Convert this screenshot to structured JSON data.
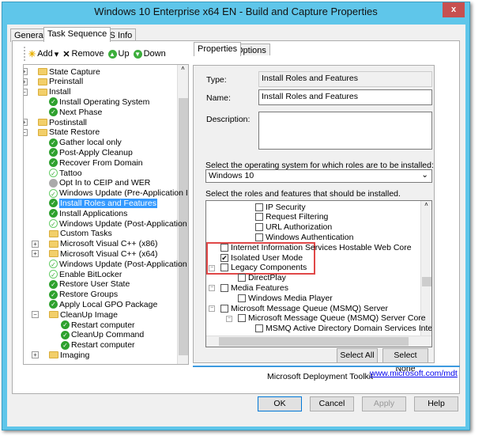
{
  "window": {
    "title": "Windows 10 Enterprise x64 EN - Build and Capture Properties",
    "close": "x"
  },
  "tabs": [
    "General",
    "Task Sequence",
    "OS Info"
  ],
  "active_tab": "Task Sequence",
  "toolbar": {
    "add": "Add",
    "remove": "Remove",
    "up": "Up",
    "down": "Down"
  },
  "tree": [
    {
      "label": "State Capture",
      "level": 0,
      "icon": "folder",
      "expander": "+"
    },
    {
      "label": "Preinstall",
      "level": 0,
      "icon": "folder",
      "expander": "+"
    },
    {
      "label": "Install",
      "level": 0,
      "icon": "folder",
      "expander": "-"
    },
    {
      "label": "Install Operating System",
      "level": 1,
      "icon": "check"
    },
    {
      "label": "Next Phase",
      "level": 1,
      "icon": "check"
    },
    {
      "label": "Postinstall",
      "level": 0,
      "icon": "folder",
      "expander": "+"
    },
    {
      "label": "State Restore",
      "level": 0,
      "icon": "folder",
      "expander": "-"
    },
    {
      "label": "Gather local only",
      "level": 1,
      "icon": "check"
    },
    {
      "label": "Post-Apply Cleanup",
      "level": 1,
      "icon": "check"
    },
    {
      "label": "Recover From Domain",
      "level": 1,
      "icon": "check"
    },
    {
      "label": "Tattoo",
      "level": 1,
      "icon": "check-light"
    },
    {
      "label": "Opt In to CEIP and WER",
      "level": 1,
      "icon": "gray"
    },
    {
      "label": "Windows Update (Pre-Application Installation)",
      "level": 1,
      "icon": "check-light"
    },
    {
      "label": "Install Roles and Features",
      "level": 1,
      "icon": "check",
      "selected": true
    },
    {
      "label": "Install Applications",
      "level": 1,
      "icon": "check"
    },
    {
      "label": "Windows Update (Post-Application Installation)",
      "level": 1,
      "icon": "check-light"
    },
    {
      "label": "Custom Tasks",
      "level": 1,
      "icon": "folder"
    },
    {
      "label": "Microsoft Visual C++  (x86)",
      "level": 1,
      "icon": "folder",
      "expander": "+"
    },
    {
      "label": "Microsoft Visual C++  (x64)",
      "level": 1,
      "icon": "folder",
      "expander": "+"
    },
    {
      "label": "Windows Update (Post-Application Installation)",
      "level": 1,
      "icon": "check-light"
    },
    {
      "label": "Enable BitLocker",
      "level": 1,
      "icon": "check-light"
    },
    {
      "label": "Restore User State",
      "level": 1,
      "icon": "check"
    },
    {
      "label": "Restore Groups",
      "level": 1,
      "icon": "check"
    },
    {
      "label": "Apply Local GPO Package",
      "level": 1,
      "icon": "check"
    },
    {
      "label": "CleanUp Image",
      "level": 1,
      "icon": "folder",
      "expander": "-"
    },
    {
      "label": "Restart computer",
      "level": 2,
      "icon": "check"
    },
    {
      "label": "CleanUp Command",
      "level": 2,
      "icon": "check"
    },
    {
      "label": "Restart computer",
      "level": 2,
      "icon": "check"
    },
    {
      "label": "Imaging",
      "level": 1,
      "icon": "folder",
      "expander": "+"
    }
  ],
  "right_tabs": [
    "Properties",
    "Options"
  ],
  "props": {
    "type_label": "Type:",
    "type_value": "Install Roles and Features",
    "name_label": "Name:",
    "name_value": "Install Roles and Features",
    "description_label": "Description:",
    "description_value": "",
    "os_prompt": "Select the operating system for which roles are to be installed:",
    "os_value": "Windows 10",
    "roles_prompt": "Select the roles and features that should be installed.",
    "select_all": "Select All",
    "select_none": "Select None"
  },
  "features": [
    {
      "label": "IP Security",
      "level": 2,
      "checked": false
    },
    {
      "label": "Request Filtering",
      "level": 2,
      "checked": false
    },
    {
      "label": "URL Authorization",
      "level": 2,
      "checked": false
    },
    {
      "label": "Windows Authentication",
      "level": 2,
      "checked": false
    },
    {
      "label": "Internet Information Services Hostable Web Core",
      "level": 0,
      "checked": false
    },
    {
      "label": "Isolated User Mode",
      "level": 0,
      "checked": true
    },
    {
      "label": "Legacy Components",
      "level": 0,
      "checked": false,
      "expander": "-"
    },
    {
      "label": "DirectPlay",
      "level": 1,
      "checked": false
    },
    {
      "label": "Media Features",
      "level": 0,
      "checked": false,
      "expander": "-"
    },
    {
      "label": "Windows Media Player",
      "level": 1,
      "checked": false
    },
    {
      "label": "Microsoft Message Queue (MSMQ) Server",
      "level": 0,
      "checked": false,
      "expander": "-"
    },
    {
      "label": "Microsoft Message Queue (MSMQ) Server Core",
      "level": 1,
      "checked": false,
      "expander": "-"
    },
    {
      "label": "MSMQ Active Directory Domain Services Integration",
      "level": 2,
      "checked": false
    }
  ],
  "footer": {
    "toolkit": "Microsoft Deployment Toolkit",
    "link": "www.microsoft.com/mdt"
  },
  "buttons": {
    "ok": "OK",
    "cancel": "Cancel",
    "apply": "Apply",
    "help": "Help"
  },
  "colors": {
    "titlebar": "#5fc6ea",
    "close": "#c75050",
    "selection": "#3399ff",
    "highlight_box": "#e04848",
    "link": "#0000ee"
  }
}
